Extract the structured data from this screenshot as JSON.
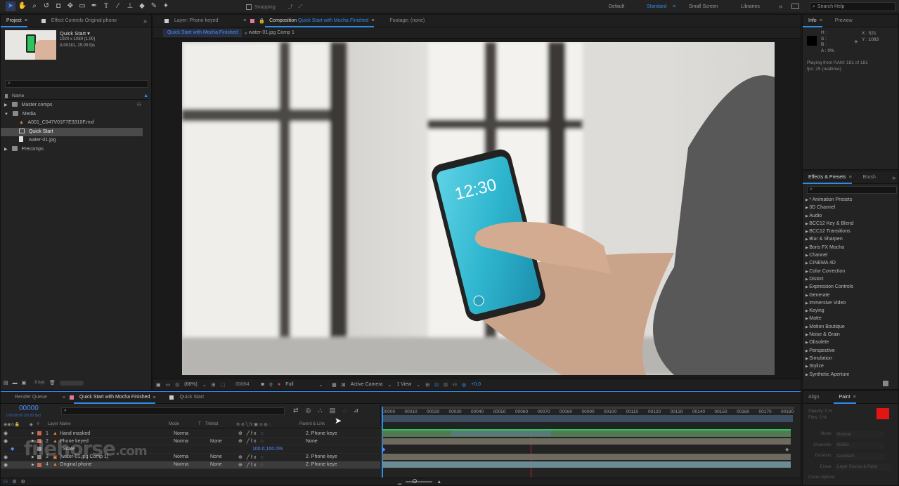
{
  "toolbar": {
    "snapping_label": "Snapping",
    "workspaces": [
      "Default",
      "Standard",
      "Small Screen",
      "Libraries"
    ],
    "more": "»",
    "search_placeholder": "Search Help"
  },
  "project_panel": {
    "tab_project": "Project",
    "tab_effect_controls": "Effect Controls Original phone",
    "more": "»",
    "thumb_name": "Quick Start ▾",
    "thumb_res": "1920 x 1080 (1.00)",
    "thumb_dur": "Δ 00181, 25.00 fps",
    "col_name": "Name",
    "items": [
      {
        "label": "Master comps",
        "type": "folder",
        "indent": 0
      },
      {
        "label": "Media",
        "type": "folder",
        "indent": 0
      },
      {
        "label": "A001_C047V01F7E3310F.mxf",
        "type": "file",
        "indent": 1
      },
      {
        "label": "Quick Start",
        "type": "comp",
        "indent": 1
      },
      {
        "label": "water-01.jpg",
        "type": "image",
        "indent": 1
      },
      {
        "label": "Precomps",
        "type": "folder",
        "indent": 0
      }
    ],
    "bpc": "8 bpc"
  },
  "viewer": {
    "tab_layer": "Layer: Phone keyed",
    "tab_comp_prefix": "Composition",
    "tab_comp_name": "Quick Start with Mocha Finished",
    "tab_footage": "Footage: (none)",
    "crumb_active": "Quick Start with Mocha Finished",
    "crumb_next": "water-01.jpg Comp 1",
    "phone_time": "12:30",
    "zoom": "(66%)",
    "timecode": "00064",
    "resolution": "Full",
    "camera": "Active Camera",
    "views": "1 View",
    "exposure": "+0.0"
  },
  "info_panel": {
    "tab_info": "Info",
    "tab_preview": "Preview",
    "r_label": "H :",
    "g_label": "S :",
    "b_label": "B :",
    "a_label": "A : 0%",
    "x": "X : 521",
    "y": "Y : 1083",
    "playing": "Playing from RAM: 181 of 181",
    "fps": "fps: 25 (realtime)"
  },
  "effects_panel": {
    "tab_effects": "Effects & Presets",
    "tab_brush": "Brush",
    "more": "»",
    "items": [
      "* Animation Presets",
      "3D Channel",
      "Audio",
      "BCC12 Key & Blend",
      "BCC12 Transitions",
      "Blur & Sharpen",
      "Boris FX Mocha",
      "Channel",
      "CINEMA 4D",
      "Color Correction",
      "Distort",
      "Expression Controls",
      "Generate",
      "Immersive Video",
      "Keying",
      "Matte",
      "Motion Boutique",
      "Noise & Grain",
      "Obsolete",
      "Perspective",
      "Simulation",
      "Stylize",
      "Synthetic Aperture"
    ]
  },
  "timeline": {
    "tab_render_queue": "Render Queue",
    "tab_comp": "Quick Start with Mocha Finished",
    "tab_comp2": "Quick Start",
    "timecode": "00000",
    "timecode_sub": "0:00:00:00 (25.00 fps)",
    "col_layer_name": "Layer Name",
    "col_mode": "Mode",
    "col_t": "T",
    "col_trkmat": "TrkMat",
    "col_parent": "Parent & Link",
    "ruler": [
      "00000",
      "00010",
      "00020",
      "00030",
      "00040",
      "00050",
      "00060",
      "00070",
      "00080",
      "00090",
      "00100",
      "00110",
      "00120",
      "00130",
      "00140",
      "00150",
      "00160",
      "00170",
      "00180"
    ],
    "layers": [
      {
        "num": "1",
        "name": "Hand masked",
        "mode": "Norma",
        "trkmat": "",
        "parent": "2. Phone keye",
        "color": "#c86a50"
      },
      {
        "num": "2",
        "name": "Phone keyed",
        "mode": "Norma",
        "trkmat": "None",
        "parent": "None",
        "color": "#c86a50"
      },
      {
        "num": "",
        "name": "Scale",
        "mode": "",
        "trkmat": "",
        "parent": "",
        "value": "100.0,100.0%",
        "color": "#888"
      },
      {
        "num": "3",
        "name": "[water-01.jpg Comp 1]",
        "mode": "Norma",
        "trkmat": "None",
        "parent": "2. Phone keye",
        "color": "#888"
      },
      {
        "num": "4",
        "name": "Original phone",
        "mode": "Norma",
        "trkmat": "None",
        "parent": "2. Phone keye",
        "color": "#c86a50"
      }
    ]
  },
  "paint_panel": {
    "tab_align": "Align",
    "tab_paint": "Paint",
    "opacity": "Opacity: 0 %",
    "flow": "Flow: 0 %",
    "mode_label": "Mode:",
    "mode_value": "Normal",
    "channels_label": "Channels:",
    "channels_value": "RGBA",
    "duration_label": "Duration:",
    "duration_value": "Constant",
    "erase_label": "Erase:",
    "erase_value": "Layer Source & Paint",
    "clone_options": "Clone Options",
    "fg_color": "#e31414"
  },
  "watermark": {
    "text": "filehorse",
    "suffix": ".com"
  }
}
